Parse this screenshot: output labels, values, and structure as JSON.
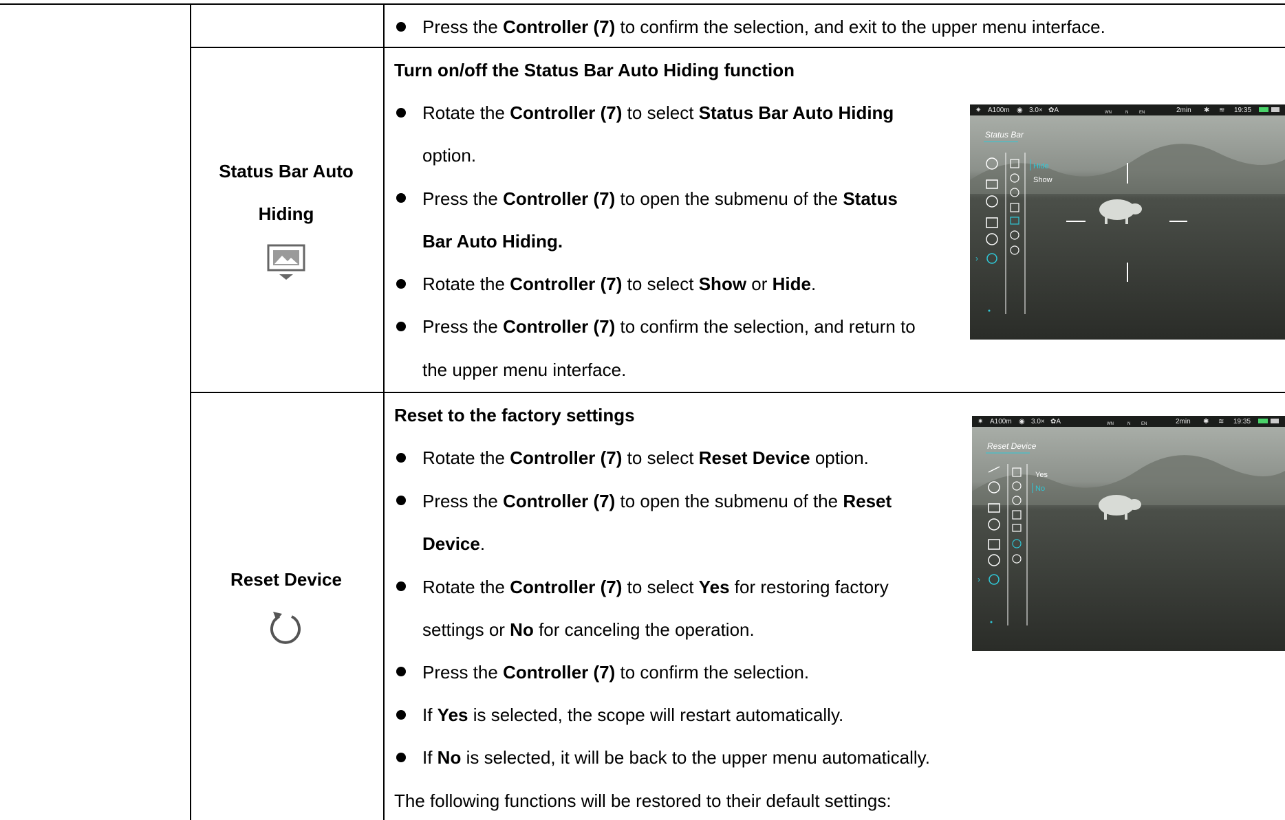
{
  "row_top": {
    "bullet1": {
      "pre": "Press the ",
      "b1": "Controller (7)",
      "post": " to confirm the selection, and exit to the upper menu interface."
    }
  },
  "status_bar": {
    "name_line1": "Status Bar Auto",
    "name_line2": "Hiding",
    "icon": "status-bar-hide-icon",
    "heading": "Turn on/off the Status Bar Auto Hiding function",
    "b1": {
      "pre": "Rotate the ",
      "k1": "Controller (7)",
      "mid": " to select ",
      "k2": "Status Bar Auto Hiding",
      "cont": "option."
    },
    "b2": {
      "pre": "Press the ",
      "k1": "Controller (7)",
      "mid": " to open the submenu of the ",
      "k2": "Status",
      "cont": "Bar Auto Hiding."
    },
    "b3": {
      "pre": "Rotate the ",
      "k1": "Controller (7)",
      "mid": " to select ",
      "k2": "Show",
      "or": " or ",
      "k3": "Hide",
      "end": "."
    },
    "b4": {
      "pre": "Press the ",
      "k1": "Controller (7)",
      "post": " to confirm the selection, and return to",
      "cont": "the upper menu interface."
    },
    "screen": {
      "status_items": [
        "A100m",
        "3.0×",
        "✿A",
        "WN",
        "N",
        "EN",
        "2min",
        "19:35"
      ],
      "menu_title": "Status Bar",
      "options": [
        "Hide",
        "Show"
      ]
    }
  },
  "reset": {
    "name": "Reset Device",
    "icon": "reset-circular-arrow-icon",
    "heading": "Reset to the factory settings",
    "b1": {
      "pre": "Rotate the ",
      "k1": "Controller (7)",
      "mid": " to select ",
      "k2": "Reset Device",
      "post": " option."
    },
    "b2": {
      "pre": "Press the ",
      "k1": "Controller (7)",
      "mid": " to open the submenu of the ",
      "k2": "Reset",
      "cont_b": "Device",
      "cont": "."
    },
    "b3": {
      "pre": "Rotate the ",
      "k1": "Controller (7)",
      "mid": " to select ",
      "k2": "Yes",
      "post": " for restoring factory",
      "cont_pre": "settings or ",
      "cont_b": "No",
      "cont_post": " for canceling the operation."
    },
    "b4": {
      "pre": "Press the ",
      "k1": "Controller (7)",
      "post": " to confirm the selection."
    },
    "b5": {
      "pre": "If ",
      "k1": "Yes",
      "post": " is selected, the scope will restart automatically."
    },
    "b6": {
      "pre": "If ",
      "k1": "No",
      "post": " is selected, it will be back to the upper menu automatically."
    },
    "footer": "The following functions will be restored to their default settings:",
    "screen": {
      "status_items": [
        "A100m",
        "3.0×",
        "✿A",
        "WN",
        "N",
        "EN",
        "2min",
        "19:35"
      ],
      "menu_title": "Reset Device",
      "options": [
        "Yes",
        "No"
      ]
    }
  },
  "colors": {
    "accent": "#2fc7d6",
    "screen_bg": "#3a3d38"
  }
}
